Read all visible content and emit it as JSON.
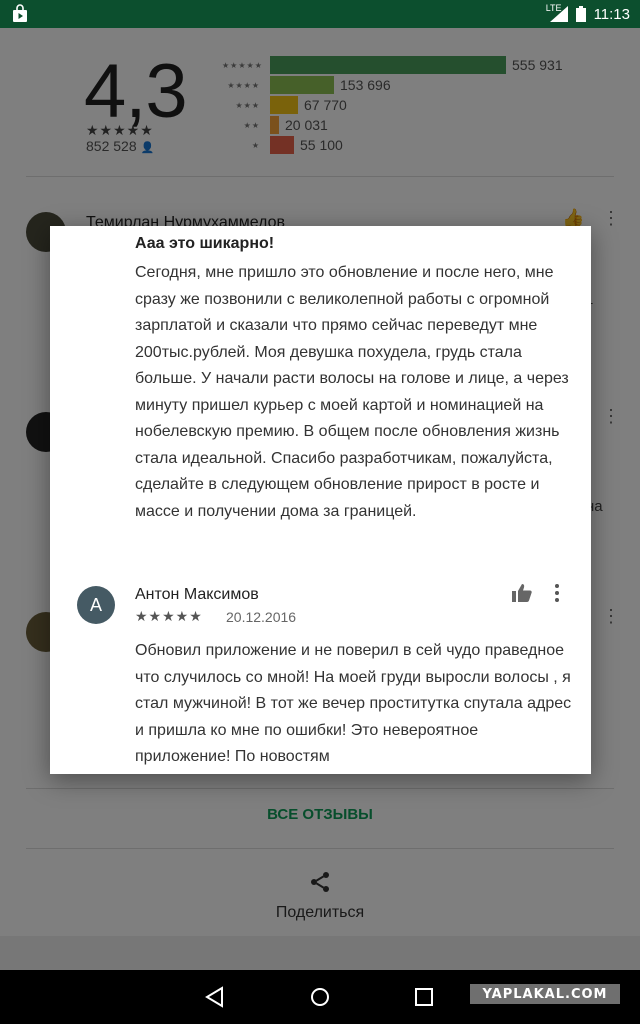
{
  "status_bar": {
    "network": "LTE",
    "time": "11:13"
  },
  "rating": {
    "score": "4,3",
    "stars": "★★★★★",
    "total": "852 528",
    "histogram": [
      {
        "stars": "★★★★★",
        "value": "555 931",
        "fraction": 1.0,
        "color": "#4a9e5c"
      },
      {
        "stars": "★★★★",
        "value": "153 696",
        "fraction": 0.27,
        "color": "#8cc152"
      },
      {
        "stars": "★★★",
        "value": "67 770",
        "fraction": 0.12,
        "color": "#f5c517"
      },
      {
        "stars": "★★",
        "value": "20 031",
        "fraction": 0.04,
        "color": "#f6a33b"
      },
      {
        "stars": "★",
        "value": "55 100",
        "fraction": 0.1,
        "color": "#e8624a"
      }
    ]
  },
  "background_reviews": {
    "first_name": "Темирлан Нурмухаммедов",
    "peek_right_1": "т",
    "peek_right_2": "на"
  },
  "dialog": {
    "title": "Ааа это шикарно!",
    "body": "Сегодня, мне пришло это обновление и после него, мне сразу же позвонили с великолепной работы с огромной зарплатой и сказали что прямо сейчас переведут мне 200тыс.рублей. Моя девушка похудела, грудь стала больше. У начали расти волосы на голове и лице, а через минуту пришел курьер с моей картой и номинацией на нобелевскую премию. В общем после обновления жизнь стала идеальной. Спасибо разработчикам, пожалуйста, сделайте в следующем обновление прирост в росте и массе и получении дома за границей.",
    "review": {
      "avatar_letter": "А",
      "author": "Антон Максимов",
      "stars": "★★★★★",
      "date": "20.12.2016",
      "text": "Обновил приложение и не поверил в сей чудо праведное что случилось со мной! На моей груди выросли волосы , я стал мужчиной! В тот же вечер проститутка спутала адрес и пришла ко мне по ошибки! Это невероятное приложение! По новостям"
    }
  },
  "all_reviews_label": "ВСЕ ОТЗЫВЫ",
  "share_label": "Поделиться",
  "watermark": "YAPLAKAL.COM",
  "colors": {
    "status_bar": "#0c4f2e",
    "accent": "#0f9d58",
    "avatar": "#455a64"
  }
}
